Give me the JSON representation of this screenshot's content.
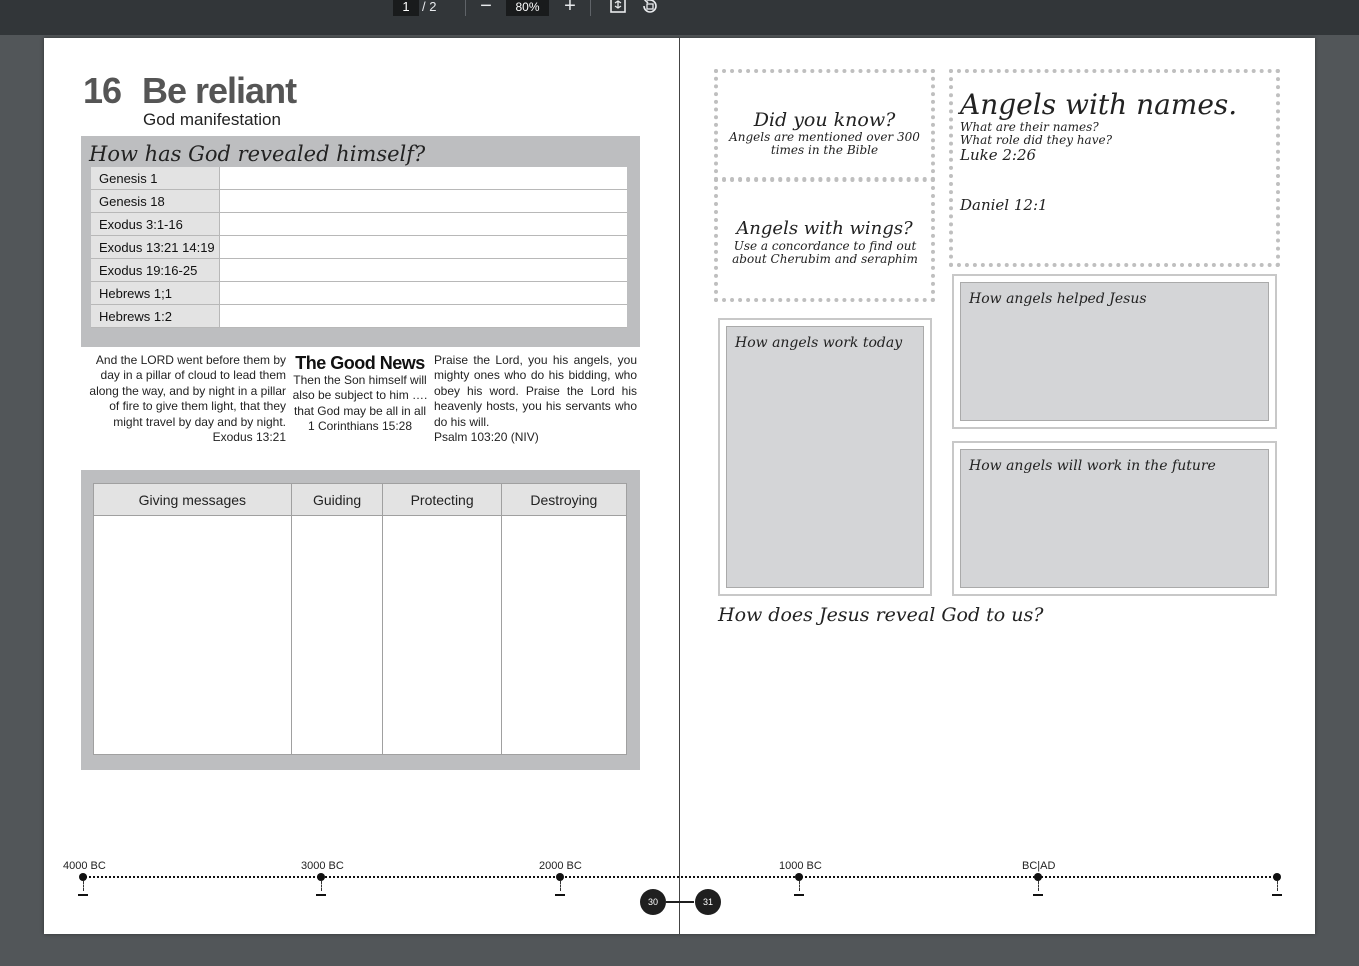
{
  "toolbar": {
    "current_page": "1",
    "total_pages": "/ 2",
    "zoom_out": "−",
    "zoom": "80%",
    "zoom_in": "+"
  },
  "left_page": {
    "lesson_number": "16",
    "title": "Be reliant",
    "subtitle": "God manifestation",
    "reveal_heading": "How has God revealed himself?",
    "references": [
      "Genesis 1",
      "Genesis 18",
      "Exodus 3:1-16",
      "Exodus 13:21  14:19",
      "Exodus 19:16-25",
      "Hebrews 1;1",
      "Hebrews 1:2"
    ],
    "quote_left": {
      "text": "And the LORD went before them by day in a pillar of cloud to lead them along the way, and by night in a pillar of fire to give them light, that they might travel by day and by night.",
      "ref": "Exodus 13:21"
    },
    "quote_center": {
      "heading": "The Good News",
      "text": "Then the Son himself will also be subject to him …. that God may be all in all",
      "ref": "1 Corinthians 15:28"
    },
    "quote_right": {
      "text": "Praise the Lord, you his angels, you mighty ones who do his bidding, who obey his word.  Praise the Lord his heavenly hosts, you his servants who do his will.",
      "ref": "Psalm 103:20 (NIV)"
    },
    "role_headers": [
      "Giving messages",
      "Guiding",
      "Protecting",
      "Destroying"
    ]
  },
  "right_page": {
    "did_you_know": {
      "title": "Did you know?",
      "text": "Angels are mentioned  over 300 times in the Bible"
    },
    "angels_wings": {
      "title": "Angels with wings?",
      "text": "Use a concordance to find out about Cherubim and seraphim"
    },
    "angels_names": {
      "title": "Angels with names.",
      "line1": "What are their names?",
      "line2": "What role did they have?",
      "ref1": "Luke 2:26",
      "ref2": "Daniel 12:1"
    },
    "panel_today": "How angels work today",
    "panel_helped": "How angels helped Jesus",
    "panel_future": "How angels will work in the future",
    "jesus_question": "How does Jesus reveal God to us?"
  },
  "timeline": {
    "labels": [
      "4000 BC",
      "3000 BC",
      "2000 BC",
      "1000 BC",
      "BC|AD"
    ],
    "page_left": "30",
    "page_right": "31"
  },
  "colors": {
    "toolbar_bg": "#323639",
    "viewer_bg": "#525659",
    "box_grey": "#bdbec0"
  }
}
